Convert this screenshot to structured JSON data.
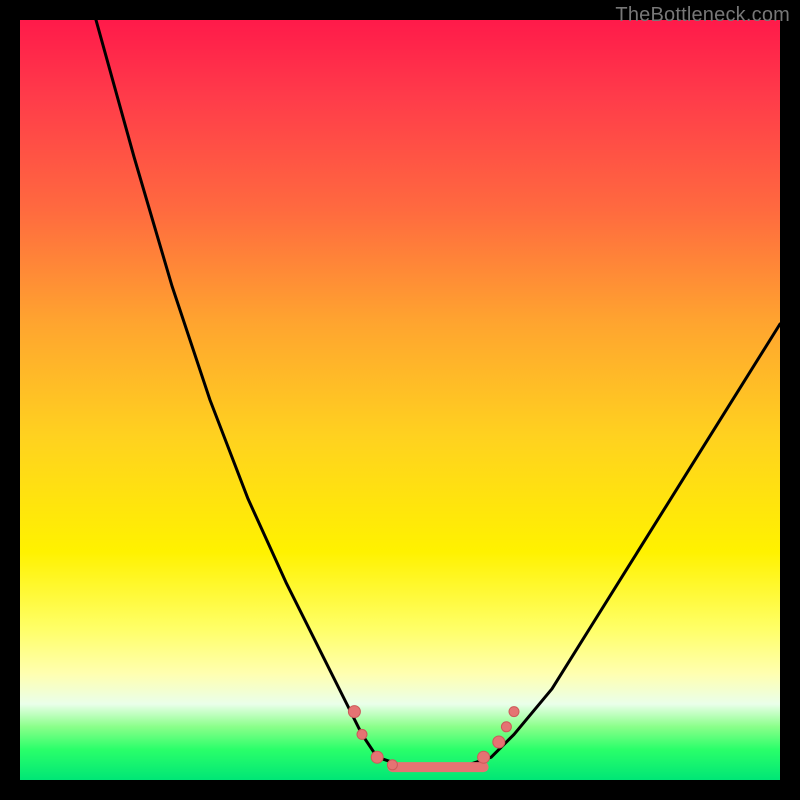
{
  "attribution": "TheBottleneck.com",
  "colors": {
    "frame_bg_top": "#ff1a4a",
    "frame_bg_bottom": "#00e676",
    "curve": "#000000",
    "marker_fill": "#e57373",
    "marker_stroke": "#cc5a5a",
    "page_bg": "#000000",
    "attribution_text": "#777777"
  },
  "chart_data": {
    "type": "line",
    "title": "",
    "xlabel": "",
    "ylabel": "",
    "xlim": [
      0,
      100
    ],
    "ylim": [
      0,
      100
    ],
    "grid": false,
    "legend": false,
    "series": [
      {
        "name": "left-branch",
        "x": [
          10,
          15,
          20,
          25,
          30,
          35,
          40,
          43,
          45,
          47
        ],
        "y": [
          100,
          82,
          65,
          50,
          37,
          26,
          16,
          10,
          6,
          3
        ]
      },
      {
        "name": "flat-valley",
        "x": [
          47,
          50,
          53,
          56,
          59,
          62
        ],
        "y": [
          3,
          2,
          1.5,
          1.5,
          2,
          3
        ]
      },
      {
        "name": "right-branch",
        "x": [
          62,
          65,
          70,
          75,
          80,
          85,
          90,
          95,
          100
        ],
        "y": [
          3,
          6,
          12,
          20,
          28,
          36,
          44,
          52,
          60
        ]
      }
    ],
    "markers": [
      {
        "x": 44,
        "y": 9,
        "r": 6
      },
      {
        "x": 45,
        "y": 6,
        "r": 5
      },
      {
        "x": 47,
        "y": 3,
        "r": 6
      },
      {
        "x": 49,
        "y": 2,
        "r": 5
      },
      {
        "x": 61,
        "y": 3,
        "r": 6
      },
      {
        "x": 63,
        "y": 5,
        "r": 6
      },
      {
        "x": 64,
        "y": 7,
        "r": 5
      },
      {
        "x": 65,
        "y": 9,
        "r": 5
      }
    ],
    "flat_segment": {
      "x0": 49,
      "x1": 61,
      "y": 1.7
    }
  }
}
